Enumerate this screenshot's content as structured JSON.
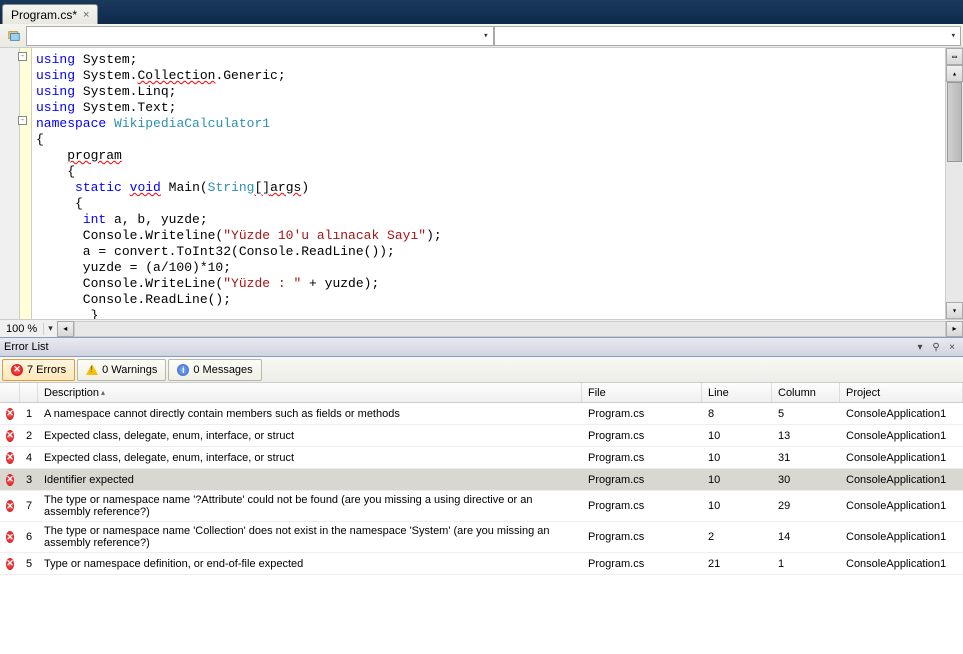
{
  "tab": {
    "title": "Program.cs*",
    "close": "×"
  },
  "zoom": "100 %",
  "code": {
    "lines": [
      {
        "t": [
          {
            "c": "k-blue",
            "v": "using"
          },
          {
            "v": " System;"
          }
        ],
        "outline": "-"
      },
      {
        "t": [
          {
            "c": "k-blue",
            "v": "using"
          },
          {
            "v": " System."
          },
          {
            "c": "squiggle",
            "v": "Collection"
          },
          {
            "v": ".Generic;"
          }
        ]
      },
      {
        "t": [
          {
            "c": "k-blue",
            "v": "using"
          },
          {
            "v": " System.Linq;"
          }
        ]
      },
      {
        "t": [
          {
            "c": "k-blue",
            "v": "using"
          },
          {
            "v": " System.Text;"
          }
        ]
      },
      {
        "t": [
          {
            "v": ""
          }
        ]
      },
      {
        "t": [
          {
            "c": "k-blue",
            "v": "namespace"
          },
          {
            "v": " "
          },
          {
            "c": "k-teal",
            "v": "WikipediaCalculator1"
          }
        ],
        "outline": "-"
      },
      {
        "t": [
          {
            "v": "{"
          }
        ]
      },
      {
        "t": [
          {
            "v": "    "
          },
          {
            "c": "squiggle",
            "v": "program"
          }
        ]
      },
      {
        "t": [
          {
            "v": "    {"
          }
        ]
      },
      {
        "t": [
          {
            "v": "     "
          },
          {
            "c": "k-blue",
            "v": "static"
          },
          {
            "v": " "
          },
          {
            "c": "k-blue squiggle",
            "v": "void"
          },
          {
            "v": " Main("
          },
          {
            "c": "k-teal",
            "v": "String"
          },
          {
            "c": "squiggle",
            "v": "[]"
          },
          {
            "c": "squiggle",
            "v": "args"
          },
          {
            "v": ")"
          }
        ]
      },
      {
        "t": [
          {
            "v": "     {"
          }
        ]
      },
      {
        "t": [
          {
            "v": "      "
          },
          {
            "c": "k-blue",
            "v": "int"
          },
          {
            "v": " a, b, yuzde;"
          }
        ]
      },
      {
        "t": [
          {
            "v": "      Console.Writeline("
          },
          {
            "c": "k-red",
            "v": "\"Yüzde 10'u alınacak Sayı\""
          },
          {
            "v": ");"
          }
        ]
      },
      {
        "t": [
          {
            "v": "      a = convert.ToInt32(Console.ReadLine());"
          }
        ]
      },
      {
        "t": [
          {
            "v": ""
          }
        ]
      },
      {
        "t": [
          {
            "v": "      yuzde = (a/100)*10;"
          }
        ]
      },
      {
        "t": [
          {
            "v": "      Console.WriteLine("
          },
          {
            "c": "k-red",
            "v": "\"Yüzde : \""
          },
          {
            "v": " + yuzde);"
          }
        ]
      },
      {
        "t": [
          {
            "v": "      Console.ReadLine();"
          }
        ]
      },
      {
        "t": [
          {
            "v": "       }"
          }
        ]
      },
      {
        "t": [
          {
            "v": "      }"
          }
        ]
      },
      {
        "t": [
          {
            "c": "squiggle",
            "v": "}"
          }
        ]
      }
    ]
  },
  "errorList": {
    "title": "Error List",
    "filters": {
      "errors": "7 Errors",
      "warnings": "0 Warnings",
      "messages": "0 Messages"
    },
    "columns": {
      "desc": "Description",
      "file": "File",
      "line": "Line",
      "col": "Column",
      "proj": "Project"
    },
    "rows": [
      {
        "n": "1",
        "desc": "A namespace cannot directly contain members such as fields or methods",
        "file": "Program.cs",
        "line": "8",
        "col": "5",
        "proj": "ConsoleApplication1"
      },
      {
        "n": "2",
        "desc": "Expected class, delegate, enum, interface, or struct",
        "file": "Program.cs",
        "line": "10",
        "col": "13",
        "proj": "ConsoleApplication1"
      },
      {
        "n": "4",
        "desc": "Expected class, delegate, enum, interface, or struct",
        "file": "Program.cs",
        "line": "10",
        "col": "31",
        "proj": "ConsoleApplication1"
      },
      {
        "n": "3",
        "desc": "Identifier expected",
        "file": "Program.cs",
        "line": "10",
        "col": "30",
        "proj": "ConsoleApplication1",
        "sel": true
      },
      {
        "n": "7",
        "desc": "The type or namespace name '?Attribute' could not be found (are you missing a using directive or an assembly reference?)",
        "file": "Program.cs",
        "line": "10",
        "col": "29",
        "proj": "ConsoleApplication1"
      },
      {
        "n": "6",
        "desc": "The type or namespace name 'Collection' does not exist in the namespace 'System' (are you missing an assembly reference?)",
        "file": "Program.cs",
        "line": "2",
        "col": "14",
        "proj": "ConsoleApplication1"
      },
      {
        "n": "5",
        "desc": "Type or namespace definition, or end-of-file expected",
        "file": "Program.cs",
        "line": "21",
        "col": "1",
        "proj": "ConsoleApplication1"
      }
    ]
  }
}
